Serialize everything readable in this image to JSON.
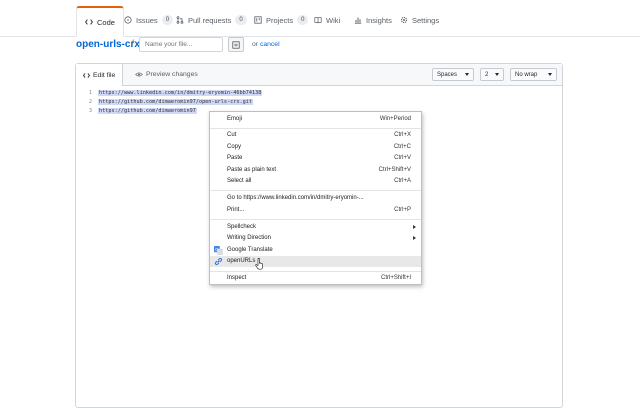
{
  "nav": {
    "tabs": [
      {
        "label": "Code",
        "icon": "code-icon"
      },
      {
        "label": "Issues",
        "count": "0",
        "icon": "issue-icon"
      },
      {
        "label": "Pull requests",
        "count": "0",
        "icon": "pull-request-icon"
      },
      {
        "label": "Projects",
        "count": "0",
        "icon": "project-icon"
      },
      {
        "label": "Wiki",
        "icon": "book-icon"
      },
      {
        "label": "Insights",
        "icon": "graph-icon"
      },
      {
        "label": "Settings",
        "icon": "gear-icon"
      }
    ],
    "accent": "#e36209"
  },
  "filename": {
    "repo": "open-urls-crx",
    "separator": "/",
    "placeholder": "Name your file...",
    "or_text": "or",
    "cancel": "cancel"
  },
  "editor": {
    "tabs": {
      "edit": "Edit file",
      "preview": "Preview changes"
    },
    "indent_mode": "Spaces",
    "indent_size": "2",
    "wrap_mode": "No wrap",
    "lines": [
      {
        "n": "1",
        "text": "https://www.linkedin.com/in/dmitry-eryomin-46bb74138"
      },
      {
        "n": "2",
        "text": "https://github.com/dimaeromin97/open-urls-crx.git"
      },
      {
        "n": "3",
        "text": "https://github.com/dimaeromin97"
      }
    ],
    "selection_color": "#cfd8f7"
  },
  "context_menu": {
    "emoji": {
      "label": "Emoji",
      "shortcut": "Win+Period"
    },
    "cut": {
      "label": "Cut",
      "shortcut": "Ctrl+X"
    },
    "copy": {
      "label": "Copy",
      "shortcut": "Ctrl+C"
    },
    "paste": {
      "label": "Paste",
      "shortcut": "Ctrl+V"
    },
    "paste_plain": {
      "label": "Paste as plain text",
      "shortcut": "Ctrl+Shift+V"
    },
    "select_all": {
      "label": "Select all",
      "shortcut": "Ctrl+A"
    },
    "goto": {
      "label": "Go to https://www.linkedin.com/in/dmitry-eryomin-..."
    },
    "print": {
      "label": "Print...",
      "shortcut": "Ctrl+P"
    },
    "spellcheck": {
      "label": "Spellcheck"
    },
    "writing_direction": {
      "label": "Writing Direction"
    },
    "google_translate": {
      "label": "Google Translate"
    },
    "openurls": {
      "label": "openURLs"
    },
    "inspect": {
      "label": "Inspect",
      "shortcut": "Ctrl+Shift+I"
    }
  }
}
